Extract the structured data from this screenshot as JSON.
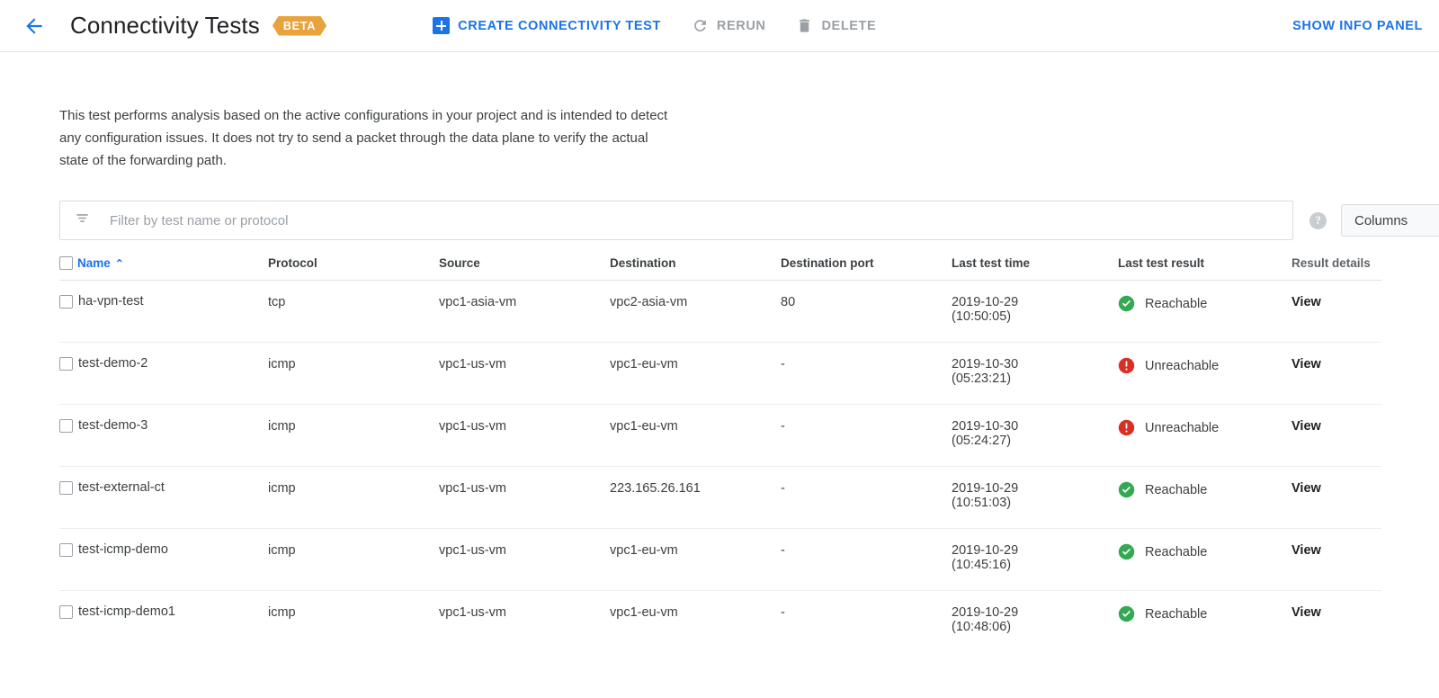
{
  "header": {
    "back_icon": "arrow-back-icon",
    "title": "Connectivity Tests",
    "badge": "BETA",
    "create_label": "CREATE CONNECTIVITY TEST",
    "create_icon": "plus-square-icon",
    "rerun_label": "RERUN",
    "rerun_icon": "refresh-icon",
    "delete_label": "DELETE",
    "delete_icon": "trash-icon",
    "info_panel_label": "SHOW INFO PANEL"
  },
  "description": "This test performs analysis based on the active configurations in your project and is intended to detect any configuration issues. It does not try to send a packet through the data plane to verify the actual state of the forwarding path.",
  "filter": {
    "icon": "filter-list-icon",
    "placeholder": "Filter by test name or protocol",
    "value": "",
    "help_icon": "help-icon",
    "help_glyph": "?",
    "columns_label": "Columns"
  },
  "table": {
    "columns": [
      "Name",
      "Protocol",
      "Source",
      "Destination",
      "Destination port",
      "Last test time",
      "Last test result",
      "Result details"
    ],
    "sort_column": "Name",
    "sort_caret": "⌃",
    "rows": [
      {
        "name": "ha-vpn-test",
        "protocol": "tcp",
        "source": "vpc1-asia-vm",
        "destination": "vpc2-asia-vm",
        "destination_port": "80",
        "test_date": "2019-10-29",
        "test_time": "(10:50:05)",
        "result": "Reachable",
        "result_icon": "check-circle-icon",
        "details": "View"
      },
      {
        "name": "test-demo-2",
        "protocol": "icmp",
        "source": "vpc1-us-vm",
        "destination": "vpc1-eu-vm",
        "destination_port": "-",
        "test_date": "2019-10-30",
        "test_time": "(05:23:21)",
        "result": "Unreachable",
        "result_icon": "error-circle-icon",
        "details": "View"
      },
      {
        "name": "test-demo-3",
        "protocol": "icmp",
        "source": "vpc1-us-vm",
        "destination": "vpc1-eu-vm",
        "destination_port": "-",
        "test_date": "2019-10-30",
        "test_time": "(05:24:27)",
        "result": "Unreachable",
        "result_icon": "error-circle-icon",
        "details": "View"
      },
      {
        "name": "test-external-ct",
        "protocol": "icmp",
        "source": "vpc1-us-vm",
        "destination": "223.165.26.161",
        "destination_port": "-",
        "test_date": "2019-10-29",
        "test_time": "(10:51:03)",
        "result": "Reachable",
        "result_icon": "check-circle-icon",
        "details": "View"
      },
      {
        "name": "test-icmp-demo",
        "protocol": "icmp",
        "source": "vpc1-us-vm",
        "destination": "vpc1-eu-vm",
        "destination_port": "-",
        "test_date": "2019-10-29",
        "test_time": "(10:45:16)",
        "result": "Reachable",
        "result_icon": "check-circle-icon",
        "details": "View"
      },
      {
        "name": "test-icmp-demo1",
        "protocol": "icmp",
        "source": "vpc1-us-vm",
        "destination": "vpc1-eu-vm",
        "destination_port": "-",
        "test_date": "2019-10-29",
        "test_time": "(10:48:06)",
        "result": "Reachable",
        "result_icon": "check-circle-icon",
        "details": "View"
      }
    ]
  },
  "colors": {
    "accent_blue": "#1a73e8",
    "beta_orange": "#e8a33d",
    "reachable_green": "#34a853",
    "unreachable_red": "#d93025",
    "disabled_grey": "#9aa0a6"
  }
}
